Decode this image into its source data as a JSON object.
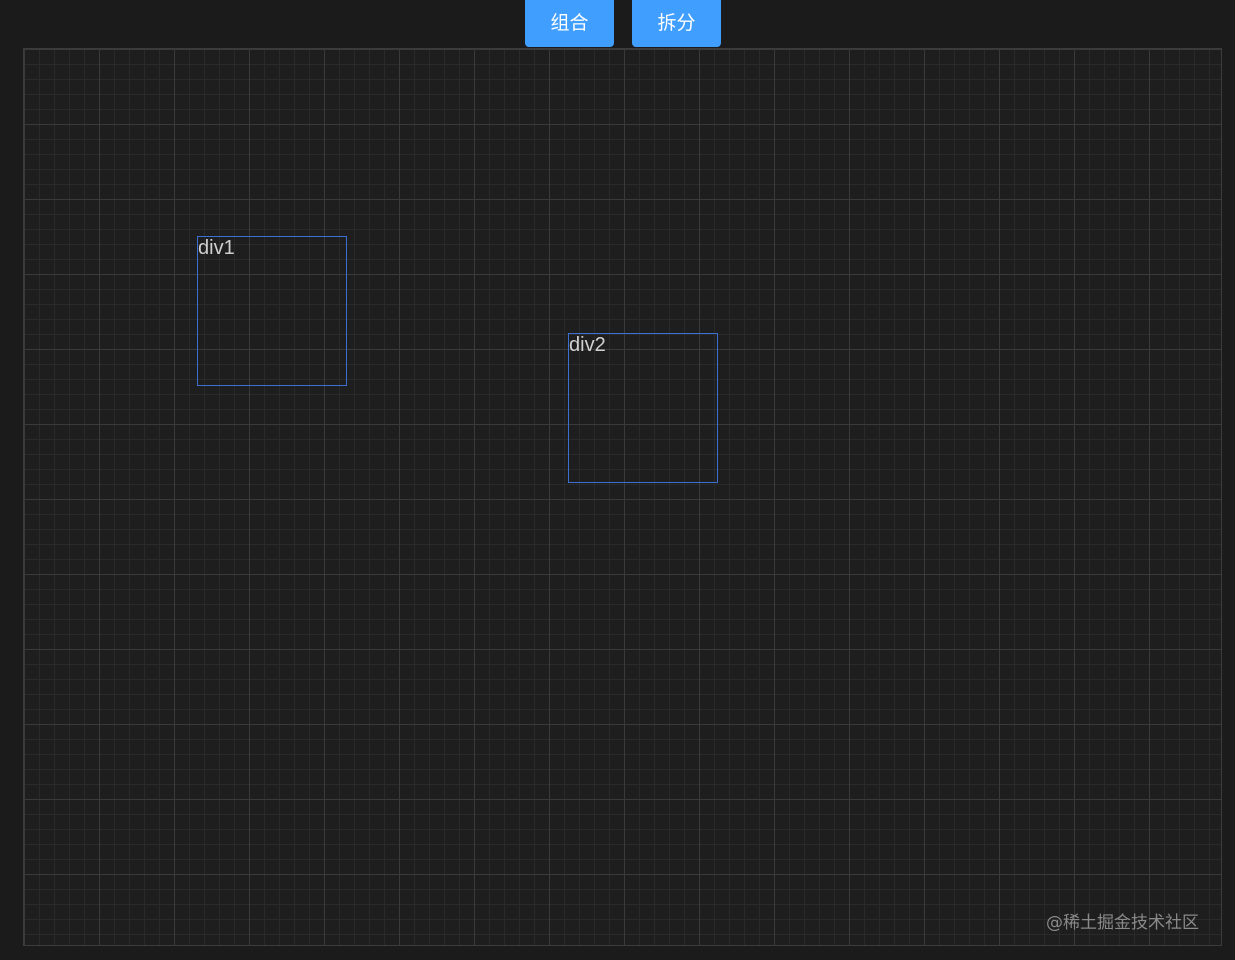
{
  "toolbar": {
    "combine_label": "组合",
    "split_label": "拆分"
  },
  "canvas": {
    "boxes": [
      {
        "label": "div1"
      },
      {
        "label": "div2"
      }
    ]
  },
  "watermark": "@稀土掘金技术社区",
  "colors": {
    "background": "#1b1b1b",
    "button": "#409eff",
    "box_border": "#3c6fd0",
    "grid_major": "#3a3a3a",
    "grid_minor": "#2a2a2a"
  }
}
